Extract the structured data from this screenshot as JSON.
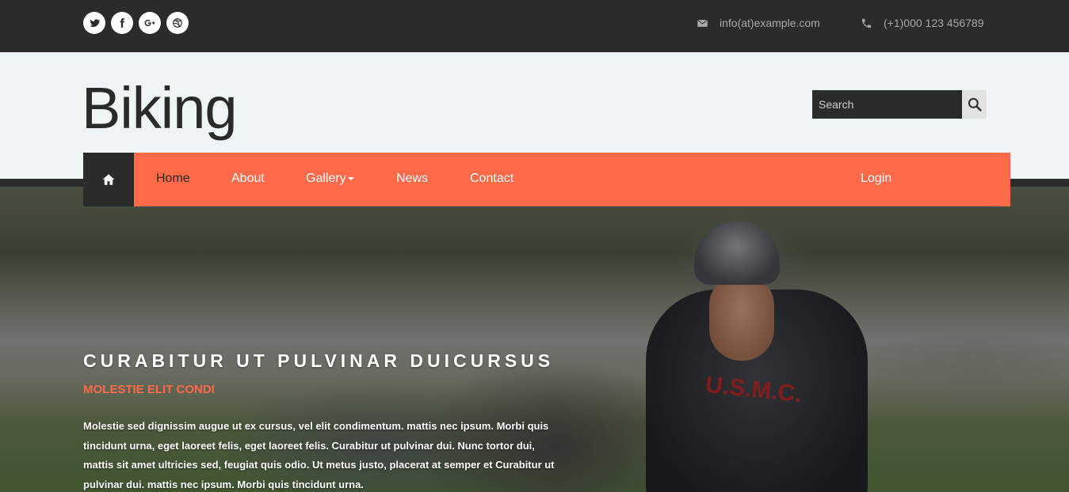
{
  "topbar": {
    "social": [
      {
        "icon": "twitter-icon"
      },
      {
        "icon": "facebook-icon"
      },
      {
        "icon": "google-plus-icon"
      },
      {
        "icon": "dribbble-icon"
      }
    ],
    "email": "info(at)example.com",
    "phone": "(+1)000 123 456789"
  },
  "header": {
    "brand": "Biking",
    "search_placeholder": "Search"
  },
  "nav": {
    "items": [
      {
        "label": "Home",
        "active": true
      },
      {
        "label": "About"
      },
      {
        "label": "Gallery",
        "dropdown": true
      },
      {
        "label": "News"
      },
      {
        "label": "Contact"
      }
    ],
    "login": "Login"
  },
  "hero": {
    "title": "CURABITUR UT PULVINAR DUICURSUS",
    "subtitle": "MOLESTIE ELIT CONDI",
    "text": "Molestie sed dignissim augue ut ex cursus, vel elit condimentum. mattis nec ipsum. Morbi quis tincidunt urna, eget laoreet felis, eget laoreet felis. Curabitur ut pulvinar dui. Nunc tortor dui, mattis sit amet ultricies sed, feugiat quis odio. Ut metus justo, placerat at semper et Curabitur ut pulvinar dui. mattis nec ipsum. Morbi quis tincidunt urna.",
    "jersey_text": "U.S.M.C."
  },
  "colors": {
    "accent": "#ff6a48",
    "dark": "#2b2b2b",
    "header_bg": "#eff4f5"
  }
}
